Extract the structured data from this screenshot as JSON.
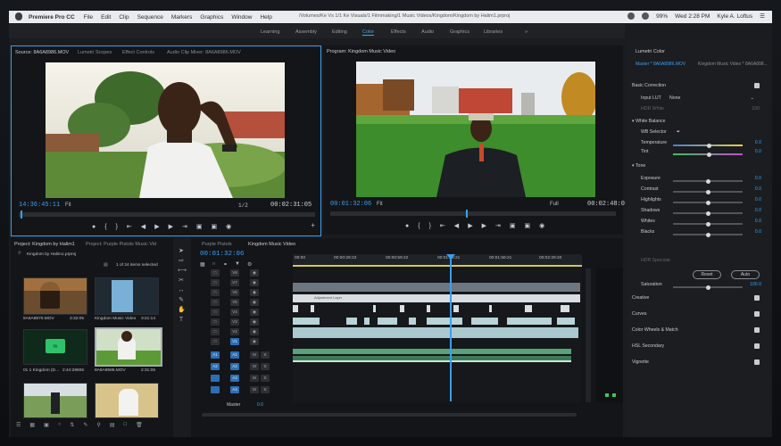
{
  "menubar": {
    "app_name": "Premiere Pro CC",
    "items": [
      "File",
      "Edit",
      "Clip",
      "Sequence",
      "Markers",
      "Graphics",
      "Window",
      "Help"
    ],
    "path": "/Volumes/Ke Vs 1/1 Ke Visuals/1 Filmmaking/1 Music Videos/Kingdom/Kingdom by Halim1.prproj",
    "battery": "99%",
    "clock": "Wed 2:28 PM",
    "user": "Kyle A. Loftus"
  },
  "workspaces": [
    "Learning",
    "Assembly",
    "Editing",
    "Color",
    "Effects",
    "Audio",
    "Graphics",
    "Libraries"
  ],
  "source": {
    "tabs": [
      "Source: 8A6A8986.MOV",
      "Lumetri Scopes",
      "Effect Controls",
      "Audio Clip Mixer: 8A6A8986.MOV"
    ],
    "timecode": "14:36:45:11",
    "fit": "Fit",
    "fraction": "1/2",
    "duration": "00:02:31:05"
  },
  "program": {
    "title": "Program: Kingdom Music Video",
    "timecode": "00:01:32:06",
    "fit": "Fit",
    "full": "Full",
    "duration": "00:02:48:0"
  },
  "project": {
    "tabs": [
      "Project: Kingdom by Halim1",
      "Project: Purple Pistols Music Vid"
    ],
    "file": "Kingdom by Halim1.prproj",
    "selected": "1 of 24 items selected",
    "items": [
      {
        "name": "8A6A8970.MOV",
        "duration": "3:32:05"
      },
      {
        "name": "Kingdom Music Video",
        "duration": "3:21:14"
      },
      {
        "name": "01 1 Kingdom (D...",
        "duration": "2:44:28606"
      },
      {
        "name": "8A6A8986.MOV",
        "duration": "2:31:05"
      },
      {
        "name": "",
        "duration": ""
      },
      {
        "name": "",
        "duration": ""
      }
    ]
  },
  "timeline": {
    "tabs": [
      "Purple Pistols",
      "Kingdom Music Video"
    ],
    "timecode": "00:01:32:06",
    "ruler": [
      "00:00",
      "00:00:29:23",
      "00:00:59:22",
      "00:01:29:21",
      "00:01:59:21",
      "00:02:29:20"
    ],
    "video_tracks": [
      "V8",
      "V7",
      "V6",
      "V5",
      "V4",
      "V3",
      "V2",
      "V1"
    ],
    "audio_tracks": [
      "A1",
      "A2",
      "A3",
      "A4"
    ],
    "master": "Master",
    "master_value": "0.0",
    "clip_label": "Adjustment Layer"
  },
  "lumetri": {
    "title": "Lumetri Color",
    "master_clip": "Master * 8A6A8986.MOV",
    "seq_clip": "Kingdom Music Video * 8A6A898...",
    "basic": "Basic Correction",
    "input_lut_label": "Input LUT",
    "input_lut_value": "None",
    "hdr_white_label": "HDR White",
    "hdr_white_value": "100",
    "white_balance": "White Balance",
    "wb_selector": "WB Selector",
    "tone": "Tone",
    "sliders": [
      {
        "label": "Temperature",
        "value": "0.0",
        "pos": 0.52
      },
      {
        "label": "Tint",
        "value": "0.0",
        "pos": 0.52
      },
      {
        "label": "Exposure",
        "value": "0.0",
        "pos": 0.5
      },
      {
        "label": "Contrast",
        "value": "0.0",
        "pos": 0.5
      },
      {
        "label": "Highlights",
        "value": "0.0",
        "pos": 0.5
      },
      {
        "label": "Shadows",
        "value": "0.0",
        "pos": 0.5
      },
      {
        "label": "Whites",
        "value": "0.0",
        "pos": 0.5
      },
      {
        "label": "Blacks",
        "value": "0.0",
        "pos": 0.5
      }
    ],
    "hdr_specular": "HDR Specular",
    "reset": "Reset",
    "auto": "Auto",
    "saturation_label": "Saturation",
    "saturation_value": "100.0",
    "sections": [
      "Creative",
      "Curves",
      "Color Wheels & Match",
      "HSL Secondary",
      "Vignette"
    ]
  },
  "colors": {
    "accent": "#3a9ff2",
    "panel": "#141518"
  }
}
